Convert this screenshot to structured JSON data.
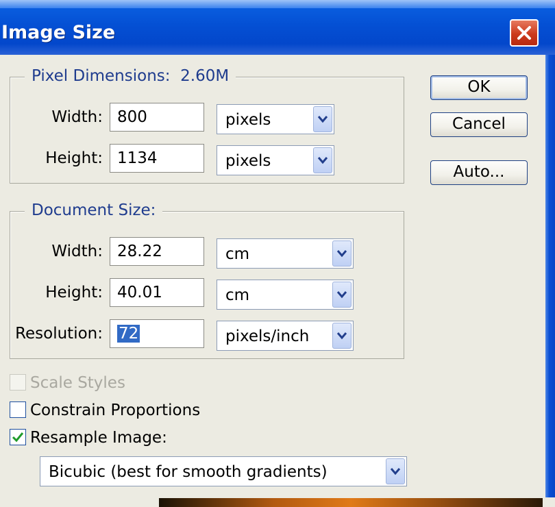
{
  "window": {
    "title": "Image Size"
  },
  "buttons": {
    "ok": "OK",
    "cancel": "Cancel",
    "auto": "Auto..."
  },
  "pixel_dimensions": {
    "legend": "Pixel Dimensions:  2.60M",
    "width": {
      "label": "Width:",
      "value": "800",
      "unit": "pixels"
    },
    "height": {
      "label": "Height:",
      "value": "1134",
      "unit": "pixels"
    }
  },
  "document_size": {
    "legend": "Document Size:",
    "width": {
      "label": "Width:",
      "value": "28.22",
      "unit": "cm"
    },
    "height": {
      "label": "Height:",
      "value": "40.01",
      "unit": "cm"
    },
    "resolution": {
      "label": "Resolution:",
      "value": "72",
      "unit": "pixels/inch"
    }
  },
  "options": {
    "scale_styles": {
      "label": "Scale Styles",
      "checked": false,
      "enabled": false
    },
    "constrain_proportions": {
      "label": "Constrain Proportions",
      "checked": false,
      "enabled": true
    },
    "resample_image": {
      "label": "Resample Image:",
      "checked": true,
      "enabled": true
    },
    "resample_method": "Bicubic (best for smooth gradients)"
  },
  "colors": {
    "titlebar": "#0450d4",
    "legend_text": "#1f3c8e",
    "dialog_bg": "#ecebe2",
    "selection": "#316ac5"
  },
  "icons": {
    "close": "close-icon",
    "dropdown": "chevron-down-icon",
    "check": "checkmark-icon"
  }
}
